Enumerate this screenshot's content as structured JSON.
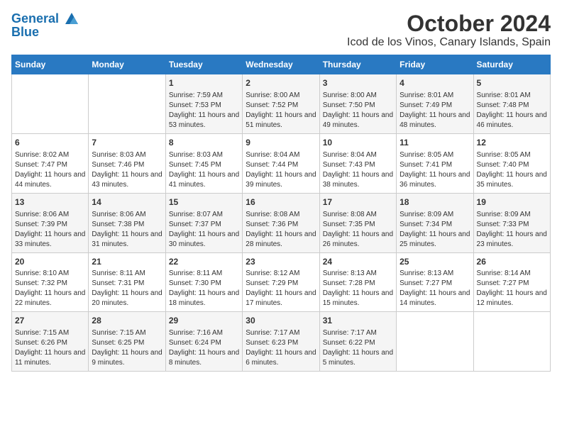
{
  "logo": {
    "line1": "General",
    "line2": "Blue"
  },
  "title": "October 2024",
  "subtitle": "Icod de los Vinos, Canary Islands, Spain",
  "days_of_week": [
    "Sunday",
    "Monday",
    "Tuesday",
    "Wednesday",
    "Thursday",
    "Friday",
    "Saturday"
  ],
  "weeks": [
    [
      {
        "day": "",
        "sunrise": "",
        "sunset": "",
        "daylight": ""
      },
      {
        "day": "",
        "sunrise": "",
        "sunset": "",
        "daylight": ""
      },
      {
        "day": "1",
        "sunrise": "Sunrise: 7:59 AM",
        "sunset": "Sunset: 7:53 PM",
        "daylight": "Daylight: 11 hours and 53 minutes."
      },
      {
        "day": "2",
        "sunrise": "Sunrise: 8:00 AM",
        "sunset": "Sunset: 7:52 PM",
        "daylight": "Daylight: 11 hours and 51 minutes."
      },
      {
        "day": "3",
        "sunrise": "Sunrise: 8:00 AM",
        "sunset": "Sunset: 7:50 PM",
        "daylight": "Daylight: 11 hours and 49 minutes."
      },
      {
        "day": "4",
        "sunrise": "Sunrise: 8:01 AM",
        "sunset": "Sunset: 7:49 PM",
        "daylight": "Daylight: 11 hours and 48 minutes."
      },
      {
        "day": "5",
        "sunrise": "Sunrise: 8:01 AM",
        "sunset": "Sunset: 7:48 PM",
        "daylight": "Daylight: 11 hours and 46 minutes."
      }
    ],
    [
      {
        "day": "6",
        "sunrise": "Sunrise: 8:02 AM",
        "sunset": "Sunset: 7:47 PM",
        "daylight": "Daylight: 11 hours and 44 minutes."
      },
      {
        "day": "7",
        "sunrise": "Sunrise: 8:03 AM",
        "sunset": "Sunset: 7:46 PM",
        "daylight": "Daylight: 11 hours and 43 minutes."
      },
      {
        "day": "8",
        "sunrise": "Sunrise: 8:03 AM",
        "sunset": "Sunset: 7:45 PM",
        "daylight": "Daylight: 11 hours and 41 minutes."
      },
      {
        "day": "9",
        "sunrise": "Sunrise: 8:04 AM",
        "sunset": "Sunset: 7:44 PM",
        "daylight": "Daylight: 11 hours and 39 minutes."
      },
      {
        "day": "10",
        "sunrise": "Sunrise: 8:04 AM",
        "sunset": "Sunset: 7:43 PM",
        "daylight": "Daylight: 11 hours and 38 minutes."
      },
      {
        "day": "11",
        "sunrise": "Sunrise: 8:05 AM",
        "sunset": "Sunset: 7:41 PM",
        "daylight": "Daylight: 11 hours and 36 minutes."
      },
      {
        "day": "12",
        "sunrise": "Sunrise: 8:05 AM",
        "sunset": "Sunset: 7:40 PM",
        "daylight": "Daylight: 11 hours and 35 minutes."
      }
    ],
    [
      {
        "day": "13",
        "sunrise": "Sunrise: 8:06 AM",
        "sunset": "Sunset: 7:39 PM",
        "daylight": "Daylight: 11 hours and 33 minutes."
      },
      {
        "day": "14",
        "sunrise": "Sunrise: 8:06 AM",
        "sunset": "Sunset: 7:38 PM",
        "daylight": "Daylight: 11 hours and 31 minutes."
      },
      {
        "day": "15",
        "sunrise": "Sunrise: 8:07 AM",
        "sunset": "Sunset: 7:37 PM",
        "daylight": "Daylight: 11 hours and 30 minutes."
      },
      {
        "day": "16",
        "sunrise": "Sunrise: 8:08 AM",
        "sunset": "Sunset: 7:36 PM",
        "daylight": "Daylight: 11 hours and 28 minutes."
      },
      {
        "day": "17",
        "sunrise": "Sunrise: 8:08 AM",
        "sunset": "Sunset: 7:35 PM",
        "daylight": "Daylight: 11 hours and 26 minutes."
      },
      {
        "day": "18",
        "sunrise": "Sunrise: 8:09 AM",
        "sunset": "Sunset: 7:34 PM",
        "daylight": "Daylight: 11 hours and 25 minutes."
      },
      {
        "day": "19",
        "sunrise": "Sunrise: 8:09 AM",
        "sunset": "Sunset: 7:33 PM",
        "daylight": "Daylight: 11 hours and 23 minutes."
      }
    ],
    [
      {
        "day": "20",
        "sunrise": "Sunrise: 8:10 AM",
        "sunset": "Sunset: 7:32 PM",
        "daylight": "Daylight: 11 hours and 22 minutes."
      },
      {
        "day": "21",
        "sunrise": "Sunrise: 8:11 AM",
        "sunset": "Sunset: 7:31 PM",
        "daylight": "Daylight: 11 hours and 20 minutes."
      },
      {
        "day": "22",
        "sunrise": "Sunrise: 8:11 AM",
        "sunset": "Sunset: 7:30 PM",
        "daylight": "Daylight: 11 hours and 18 minutes."
      },
      {
        "day": "23",
        "sunrise": "Sunrise: 8:12 AM",
        "sunset": "Sunset: 7:29 PM",
        "daylight": "Daylight: 11 hours and 17 minutes."
      },
      {
        "day": "24",
        "sunrise": "Sunrise: 8:13 AM",
        "sunset": "Sunset: 7:28 PM",
        "daylight": "Daylight: 11 hours and 15 minutes."
      },
      {
        "day": "25",
        "sunrise": "Sunrise: 8:13 AM",
        "sunset": "Sunset: 7:27 PM",
        "daylight": "Daylight: 11 hours and 14 minutes."
      },
      {
        "day": "26",
        "sunrise": "Sunrise: 8:14 AM",
        "sunset": "Sunset: 7:27 PM",
        "daylight": "Daylight: 11 hours and 12 minutes."
      }
    ],
    [
      {
        "day": "27",
        "sunrise": "Sunrise: 7:15 AM",
        "sunset": "Sunset: 6:26 PM",
        "daylight": "Daylight: 11 hours and 11 minutes."
      },
      {
        "day": "28",
        "sunrise": "Sunrise: 7:15 AM",
        "sunset": "Sunset: 6:25 PM",
        "daylight": "Daylight: 11 hours and 9 minutes."
      },
      {
        "day": "29",
        "sunrise": "Sunrise: 7:16 AM",
        "sunset": "Sunset: 6:24 PM",
        "daylight": "Daylight: 11 hours and 8 minutes."
      },
      {
        "day": "30",
        "sunrise": "Sunrise: 7:17 AM",
        "sunset": "Sunset: 6:23 PM",
        "daylight": "Daylight: 11 hours and 6 minutes."
      },
      {
        "day": "31",
        "sunrise": "Sunrise: 7:17 AM",
        "sunset": "Sunset: 6:22 PM",
        "daylight": "Daylight: 11 hours and 5 minutes."
      },
      {
        "day": "",
        "sunrise": "",
        "sunset": "",
        "daylight": ""
      },
      {
        "day": "",
        "sunrise": "",
        "sunset": "",
        "daylight": ""
      }
    ]
  ]
}
